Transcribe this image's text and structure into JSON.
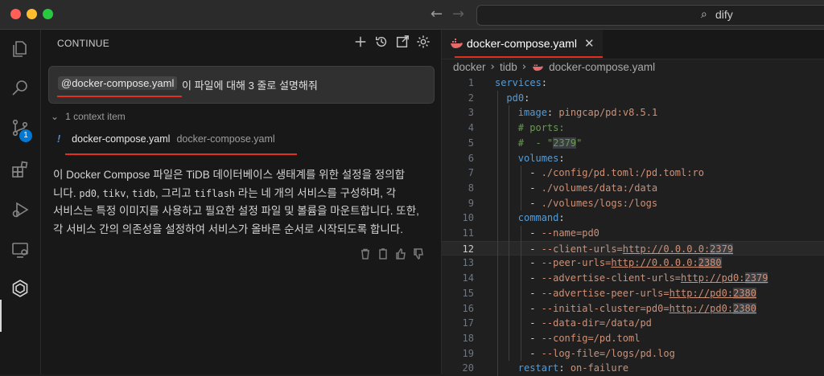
{
  "window": {
    "search": "dify",
    "back_icon": "arrow-left-icon",
    "forward_icon": "arrow-right-icon"
  },
  "activity_bar": {
    "scm_badge": "1"
  },
  "sidebar": {
    "title": "CONTINUE",
    "prompt": {
      "mention": "@docker-compose.yaml",
      "text": "이 파일에 대해 3 줄로 설명해줘"
    },
    "context_summary": "1 context item",
    "context_item": {
      "marker": "!",
      "name": "docker-compose.yaml",
      "path": "docker-compose.yaml"
    },
    "answer": {
      "l1": "이 Docker Compose 파일은 TiDB 데이터베이스 생태계를 위한 설정을 정의합",
      "l2a": "니다.",
      "c1": "pd0",
      "sep1": ",",
      "c2": "tikv",
      "sep2": ",",
      "c3": "tidb",
      "l2b": ", 그리고",
      "c4": "tiflash",
      "l2c": "라는 네 개의 서비스를 구성하며, 각",
      "l3": "서비스는 특정 이미지를 사용하고 필요한 설정 파일 및 볼륨을 마운트합니다. 또한,",
      "l4": "각 서비스 간의 의존성을 설정하여 서비스가 올바른 순서로 시작되도록 합니다."
    }
  },
  "editor": {
    "tab": {
      "label": "docker-compose.yaml",
      "close": "✕"
    },
    "breadcrumb": [
      "docker",
      "tidb",
      "docker-compose.yaml"
    ],
    "current_line": 12,
    "lines": [
      {
        "n": "1",
        "t": "services:"
      },
      {
        "n": "2",
        "t": "pd0:"
      },
      {
        "n": "3",
        "t": "image: pingcap/pd:v8.5.1"
      },
      {
        "n": "4",
        "t": "# ports:"
      },
      {
        "n": "5",
        "t": "#  - \"2379\""
      },
      {
        "n": "6",
        "t": "volumes:"
      },
      {
        "n": "7",
        "t": "- ./config/pd.toml:/pd.toml:ro"
      },
      {
        "n": "8",
        "t": "- ./volumes/data:/data"
      },
      {
        "n": "9",
        "t": "- ./volumes/logs:/logs"
      },
      {
        "n": "10",
        "t": "command:"
      },
      {
        "n": "11",
        "t": "- --name=pd0"
      },
      {
        "n": "12",
        "t": "- --client-urls=http://0.0.0.0:2379"
      },
      {
        "n": "13",
        "t": "- --peer-urls=http://0.0.0.0:2380"
      },
      {
        "n": "14",
        "t": "- --advertise-client-urls=http://pd0:2379"
      },
      {
        "n": "15",
        "t": "- --advertise-peer-urls=http://pd0:2380"
      },
      {
        "n": "16",
        "t": "- --initial-cluster=pd0=http://pd0:2380"
      },
      {
        "n": "17",
        "t": "- --data-dir=/data/pd"
      },
      {
        "n": "18",
        "t": "- --config=/pd.toml"
      },
      {
        "n": "19",
        "t": "- --log-file=/logs/pd.log"
      },
      {
        "n": "20",
        "t": "restart: on-failure"
      }
    ]
  }
}
